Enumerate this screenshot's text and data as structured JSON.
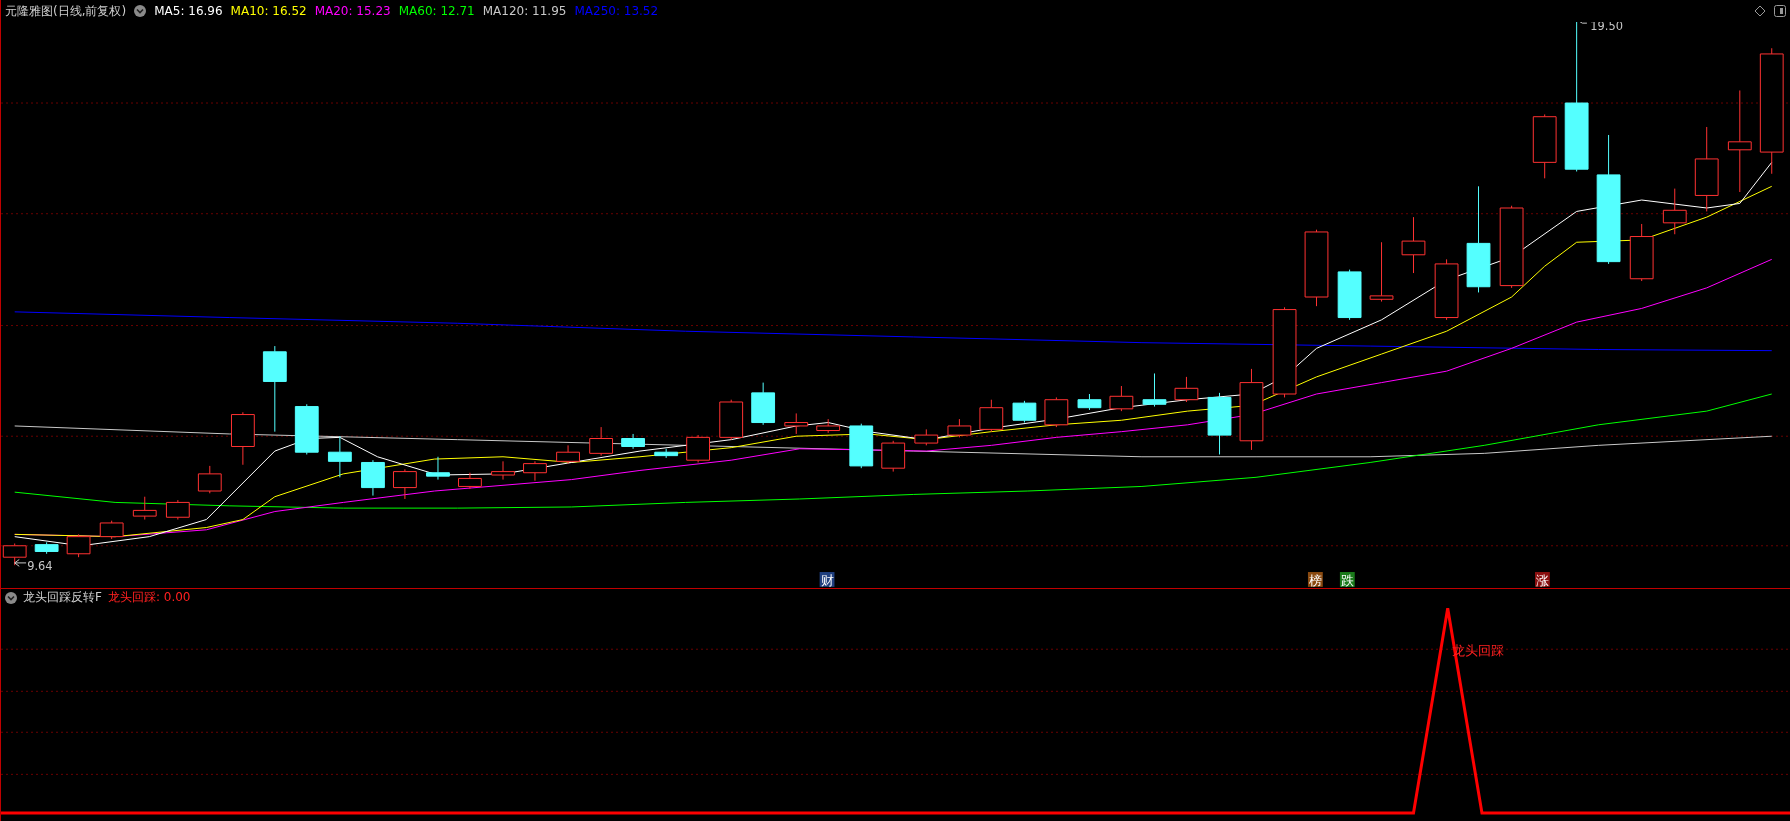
{
  "main_chart": {
    "title": "元隆雅图(日线,前复权)",
    "indicators": [
      {
        "label": "MA5: 16.96",
        "color": "#ffffff"
      },
      {
        "label": "MA10: 16.52",
        "color": "#ffff00"
      },
      {
        "label": "MA20: 15.23",
        "color": "#ff00ff"
      },
      {
        "label": "MA60: 12.71",
        "color": "#00ff00"
      },
      {
        "label": "MA120: 11.95",
        "color": "#c8c8c8"
      },
      {
        "label": "MA250: 13.52",
        "color": "#0000ff"
      }
    ],
    "price_labels": {
      "high": "19.50",
      "low": "9.64"
    },
    "events": [
      {
        "label": "财",
        "color": "#1f3f7f"
      },
      {
        "label": "榜",
        "color": "#8a4a10"
      },
      {
        "label": "跌",
        "color": "#1a7a1a"
      },
      {
        "label": "涨",
        "color": "#8a1010"
      }
    ]
  },
  "sub_chart": {
    "title": "龙头回踩反转F",
    "readout": "龙头回踩: 0.00",
    "signal_label": "龙头回踩"
  }
}
